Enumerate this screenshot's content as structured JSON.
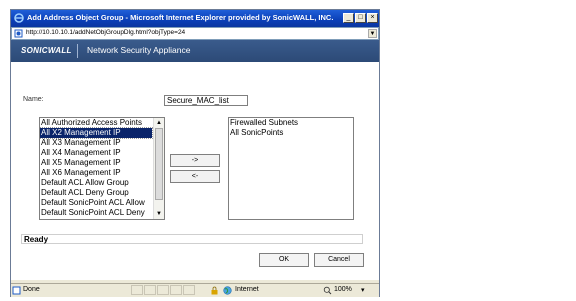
{
  "window": {
    "title": "Add Address Object Group - Microsoft Internet Explorer provided by SonicWALL, INC.",
    "minimize_glyph": "_",
    "maximize_glyph": "□",
    "close_glyph": "×"
  },
  "address_bar": {
    "url": "http://10.10.10.1/addNetObjGroupDlg.html?objType=24"
  },
  "banner": {
    "logo": "SONICWALL",
    "product": "Network Security Appliance"
  },
  "form": {
    "name_label": "Name:",
    "name_value": "Secure_MAC_list",
    "available_items": [
      "All Authorized Access Points",
      "All X2 Management IP",
      "All X3 Management IP",
      "All X4 Management IP",
      "All X5 Management IP",
      "All X6 Management IP",
      "Default ACL Allow Group",
      "Default ACL Deny Group",
      "Default SonicPoint ACL Allow",
      "Default SonicPoint ACL Deny"
    ],
    "selected_index": 1,
    "member_items": [
      "Firewalled Subnets",
      "All SonicPoints"
    ],
    "add_button": "->",
    "remove_button": "<-",
    "status": "Ready",
    "ok_button": "OK",
    "cancel_button": "Cancel"
  },
  "statusbar": {
    "left": "Done",
    "zone": "Internet",
    "zoom": "100%"
  }
}
